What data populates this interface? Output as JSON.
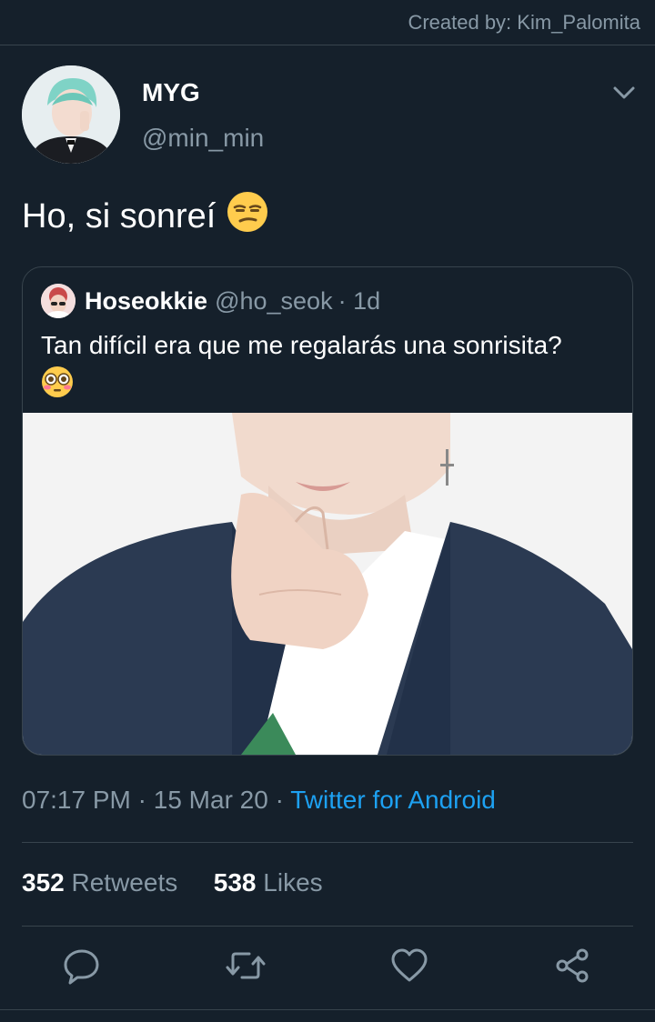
{
  "credit": "Created by: Kim_Palomita",
  "tweet": {
    "display_name": "MYG",
    "handle": "@min_min",
    "text": "Ho, si sonreí"
  },
  "quoted": {
    "name": "Hoseokkie",
    "handle": "@ho_seok",
    "age": "· 1d",
    "text": "Tan difícil era que me regalarás una sonrisita?"
  },
  "meta": {
    "time": "07:17 PM",
    "date": "· 15 Mar 20 ·",
    "source": "Twitter for Android"
  },
  "stats": {
    "retweets_count": "352",
    "retweets_label": "Retweets",
    "likes_count": "538",
    "likes_label": "Likes"
  },
  "icons": {
    "reply": "reply-icon",
    "retweet": "retweet-icon",
    "like": "heart-icon",
    "share": "share-icon",
    "menu": "chevron-down-icon"
  },
  "colors": {
    "background": "#15202b",
    "link": "#1da1f2",
    "muted": "#8899a6",
    "divider": "#38444d"
  }
}
